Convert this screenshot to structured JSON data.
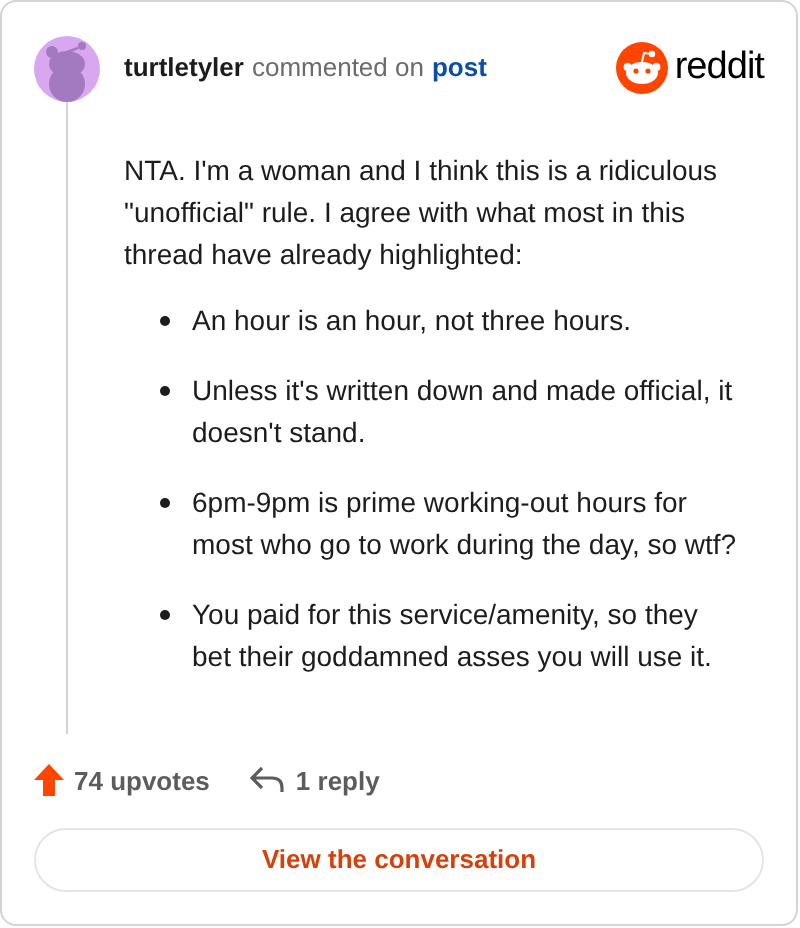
{
  "header": {
    "username": "turtletyler",
    "action": "commented on",
    "link": "post",
    "brand": "reddit"
  },
  "comment": {
    "intro": "NTA. I'm a woman and I think this is a ridiculous \"unofficial\" rule. I agree with what most in this thread have already highlighted:",
    "bullets": [
      "An hour is an hour, not three hours.",
      "Unless it's written down and made official, it doesn't stand.",
      "6pm-9pm is prime working-out hours for most who go to work during the day, so wtf?",
      "You paid for this service/amenity, so they bet their goddamned asses you will use it."
    ]
  },
  "footer": {
    "upvotes": "74 upvotes",
    "replies": "1 reply",
    "button": "View the conversation"
  }
}
